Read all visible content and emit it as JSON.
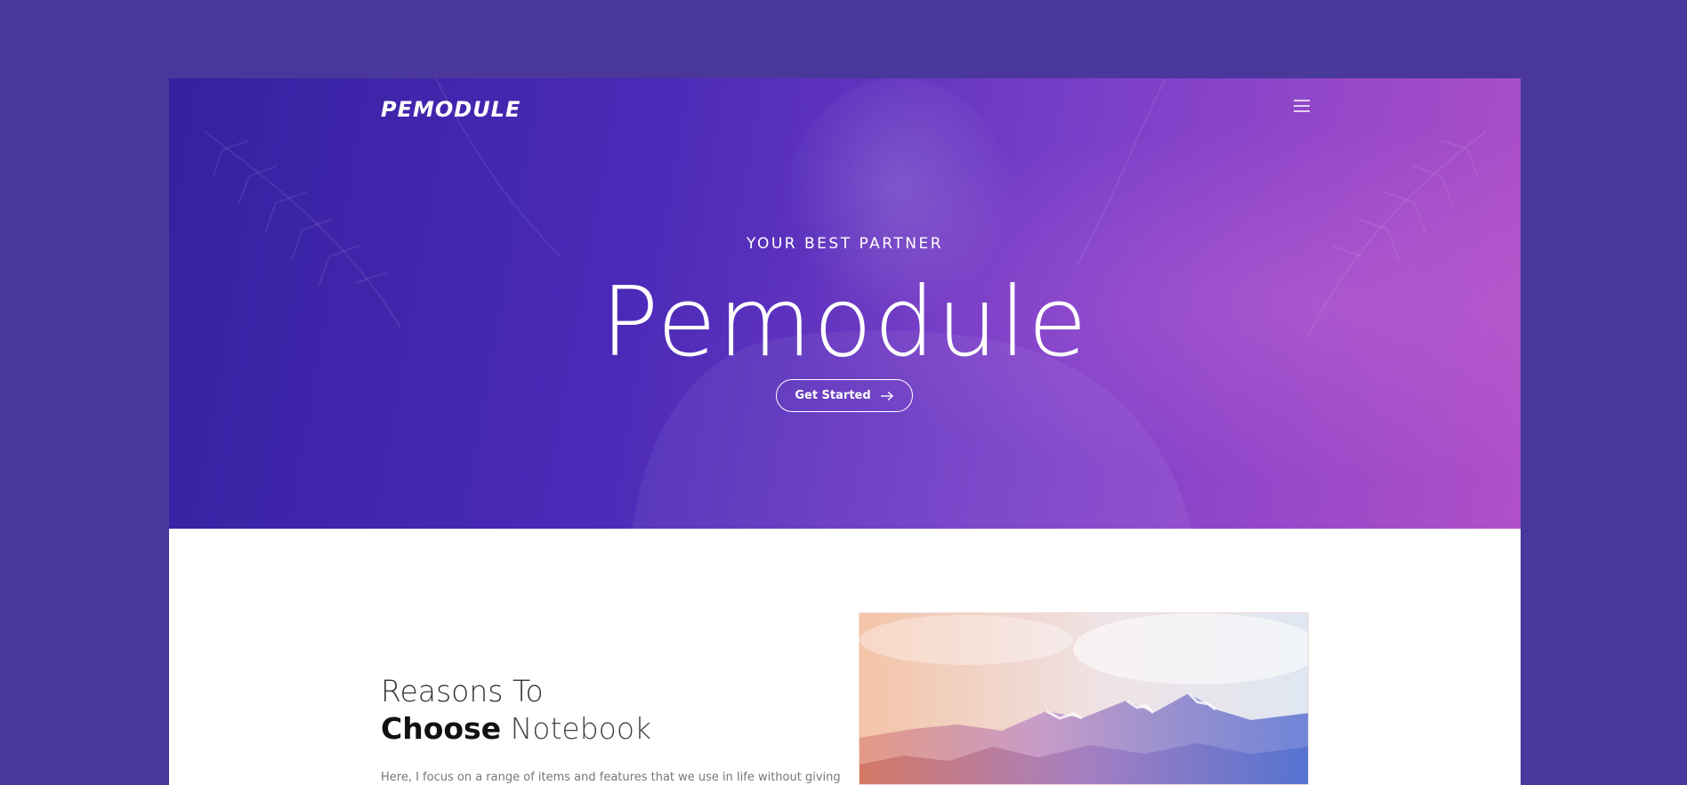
{
  "header": {
    "logo_text": "PEMODULE",
    "menu_icon": "hamburger-icon"
  },
  "hero": {
    "eyebrow": "YOUR BEST PARTNER",
    "title": "Pemodule",
    "cta_label": "Get Started",
    "cta_icon": "arrow-right-icon"
  },
  "section": {
    "title_line1": "Reasons To",
    "title_strong": "Choose",
    "title_light": "Notebook",
    "body": "Here, I focus on a range of items and features that we use in life without giving"
  },
  "colors": {
    "page_bg": "#4a379c",
    "hero_gradient_start": "#3521a0",
    "hero_gradient_end": "#b050c8",
    "content_bg": "#ffffff"
  }
}
